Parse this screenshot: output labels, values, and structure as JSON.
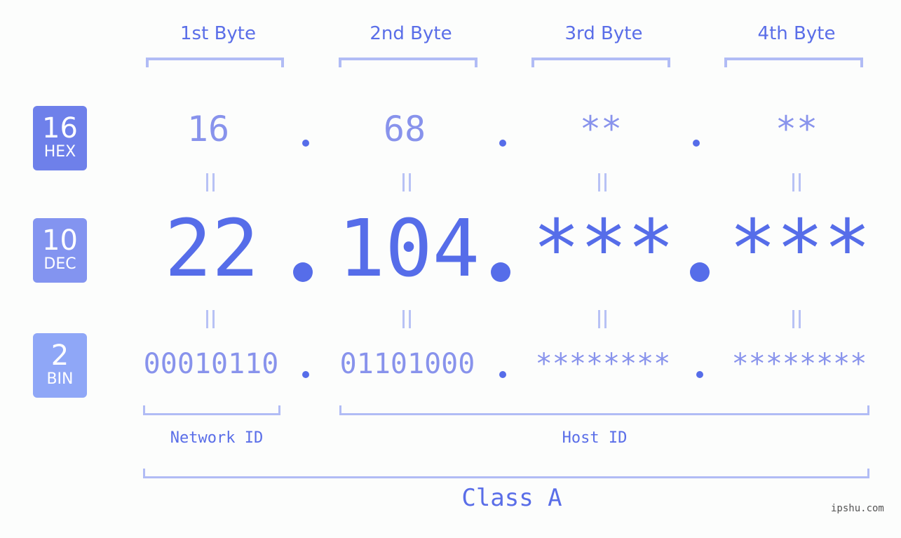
{
  "byte_headers": [
    "1st Byte",
    "2nd Byte",
    "3rd Byte",
    "4th Byte"
  ],
  "badges": {
    "hex": {
      "number": "16",
      "label": "HEX",
      "color": "#6e80ea"
    },
    "dec": {
      "number": "10",
      "label": "DEC",
      "color": "#8394f0"
    },
    "bin": {
      "number": "2",
      "label": "BIN",
      "color": "#8fa7f7"
    }
  },
  "hex_values": [
    "16",
    "68",
    "**",
    "**"
  ],
  "dec_values": [
    "22",
    "104",
    "***",
    "***"
  ],
  "bin_values": [
    "00010110",
    "01101000",
    "********",
    "********"
  ],
  "labels": {
    "network_id": "Network ID",
    "host_id": "Host ID",
    "class": "Class A"
  },
  "watermark": "ipshu.com",
  "colors": {
    "accent": "#566de9",
    "light_accent": "#8893ec",
    "bracket": "#b1bcf5"
  }
}
